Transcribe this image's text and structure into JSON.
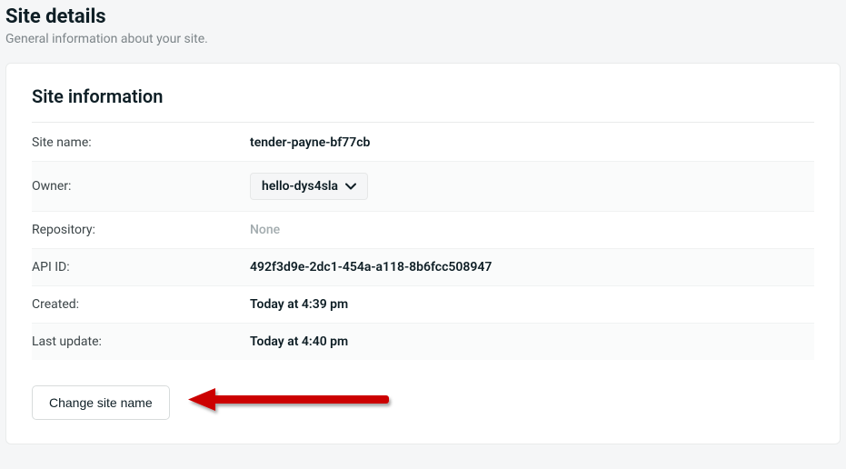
{
  "page": {
    "title": "Site details",
    "subtitle": "General information about your site."
  },
  "card": {
    "title": "Site information",
    "rows": {
      "site_name": {
        "label": "Site name:",
        "value": "tender-payne-bf77cb"
      },
      "owner": {
        "label": "Owner:",
        "value": "hello-dys4sla"
      },
      "repository": {
        "label": "Repository:",
        "value": "None"
      },
      "api_id": {
        "label": "API ID:",
        "value": "492f3d9e-2dc1-454a-a118-8b6fcc508947"
      },
      "created": {
        "label": "Created:",
        "value": "Today at 4:39 pm"
      },
      "last_update": {
        "label": "Last update:",
        "value": "Today at 4:40 pm"
      }
    },
    "actions": {
      "change_site_name": "Change site name"
    }
  }
}
